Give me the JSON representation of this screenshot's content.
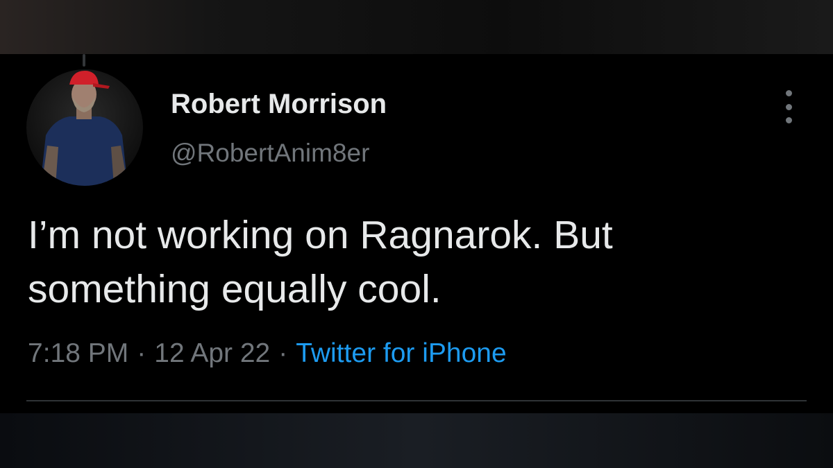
{
  "tweet": {
    "display_name": "Robert Morrison",
    "handle": "@RobertAnim8er",
    "text_lines": [
      "I’m not working on Ragnarok. But",
      "something equally cool."
    ],
    "time": "7:18 PM",
    "date": "12 Apr 22",
    "separator": "·",
    "source": "Twitter for iPhone"
  },
  "icons": {
    "more": "more-vertical-icon",
    "avatar": "profile-photo"
  },
  "colors": {
    "background": "#000000",
    "primary_text": "#e7e9ea",
    "secondary_text": "#71767b",
    "link": "#1d9bf0",
    "divider": "#2f3336",
    "thread_line": "#333639"
  }
}
